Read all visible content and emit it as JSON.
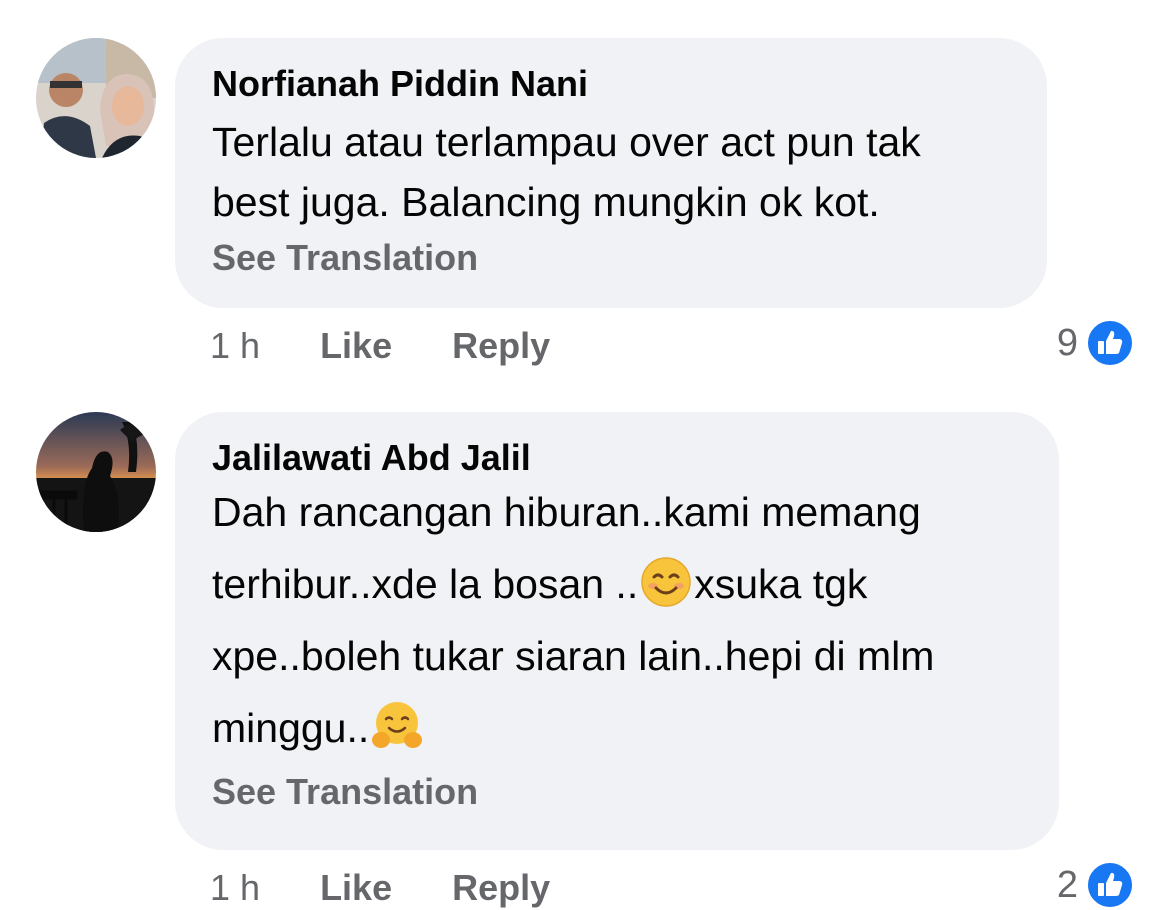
{
  "comments": [
    {
      "author": "Norfianah Piddin Nani",
      "lines": [
        "Terlalu atau terlampau over act pun tak",
        "best juga. Balancing mungkin ok kot."
      ],
      "see_translation": "See Translation",
      "time": "1 h",
      "like_label": "Like",
      "reply_label": "Reply",
      "reaction_count": "9",
      "reaction_icon": "like-icon"
    },
    {
      "author": "Jalilawati Abd Jalil",
      "line1": "Dah rancangan hiburan..kami memang",
      "line2a": "terhibur..xde la bosan ..",
      "line2b": "xsuka tgk",
      "line3": "xpe..boleh tukar siaran lain..hepi di mlm",
      "line4": "minggu..",
      "emoji_1": "smiling-face-emoji",
      "emoji_2": "hugging-face-emoji",
      "see_translation": "See Translation",
      "time": "1 h",
      "like_label": "Like",
      "reply_label": "Reply",
      "reaction_count": "2",
      "reaction_icon": "like-icon"
    }
  ],
  "colors": {
    "bubble": "#f0f2f5",
    "secondary_text": "#65676b",
    "like_blue": "#1877f2"
  }
}
